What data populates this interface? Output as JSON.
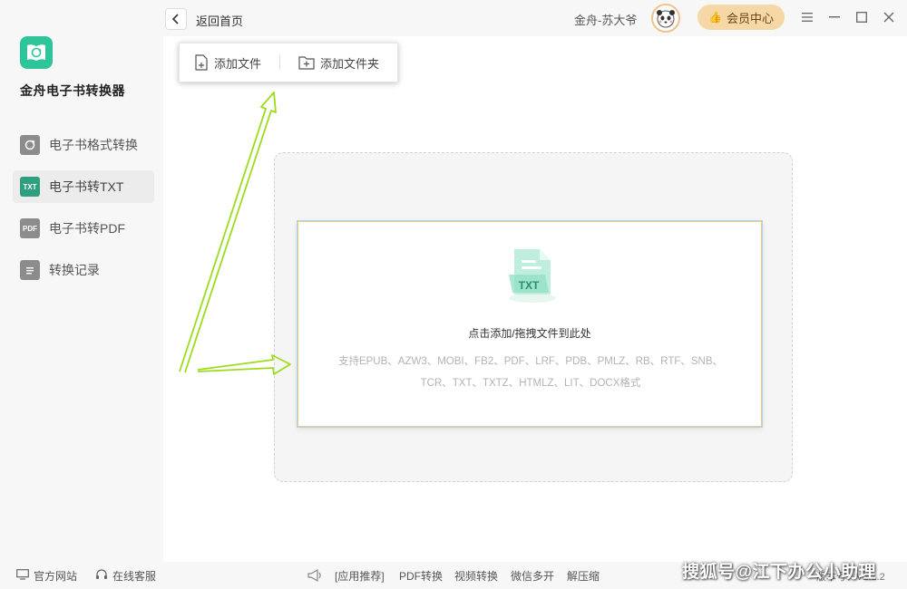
{
  "app": {
    "name": "金舟电子书转换器"
  },
  "sidebar": {
    "items": [
      {
        "label": "电子书格式转换",
        "icon": "refresh-book-icon",
        "badge": ""
      },
      {
        "label": "电子书转TXT",
        "icon": "txt-icon",
        "badge": "TXT"
      },
      {
        "label": "电子书转PDF",
        "icon": "pdf-icon",
        "badge": "PDF"
      },
      {
        "label": "转换记录",
        "icon": "record-icon",
        "badge": ""
      }
    ],
    "active_index": 1
  },
  "topbar": {
    "back_label": "返回首页",
    "username": "金舟-苏大爷",
    "vip_label": "会员中心"
  },
  "popup": {
    "add_file": "添加文件",
    "add_folder": "添加文件夹"
  },
  "dropzone": {
    "title": "点击添加/拖拽文件到此处",
    "formats_line1": "支持EPUB、AZW3、MOBI、FB2、PDF、LRF、PDB、PMLZ、RB、RTF、SNB、",
    "formats_line2": "TCR、TXT、TXTZ、HTMLZ、LIT、DOCX格式",
    "illustration_text": "TXT"
  },
  "footer": {
    "official_site": "官方网站",
    "online_service": "在线客服",
    "recommend": "[应用推荐]",
    "links": [
      "PDF转换",
      "视频转换",
      "微信多开",
      "解压缩"
    ],
    "version": "版本号：V2.1.2"
  },
  "watermark": "搜狐号@江下办公小助理",
  "colors": {
    "accent": "#2f9f80",
    "vip_bg": "#f6d7a6",
    "arrow": "#9ddc1c"
  }
}
